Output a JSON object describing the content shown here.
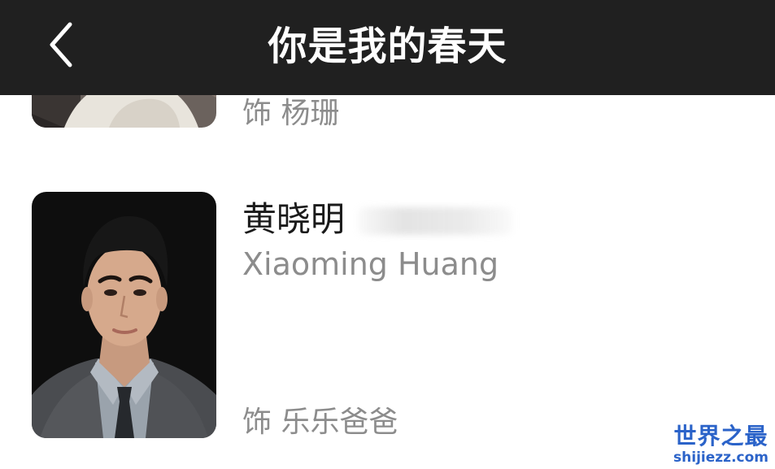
{
  "header": {
    "title": "你是我的春天",
    "back_icon": "chevron-left-icon"
  },
  "cast": [
    {
      "role": "饰 杨珊"
    },
    {
      "name_cn": "黄晓明",
      "name_en": "Xiaoming Huang",
      "role": "饰 乐乐爸爸"
    }
  ],
  "watermark": {
    "cn": "世界之最",
    "en": "shijiezz.com"
  },
  "colors": {
    "header_bg": "#202020",
    "header_text": "#ffffff",
    "name_text": "#1a1a1a",
    "secondary_text": "#8c8c8c",
    "watermark": "#2b63c9"
  }
}
